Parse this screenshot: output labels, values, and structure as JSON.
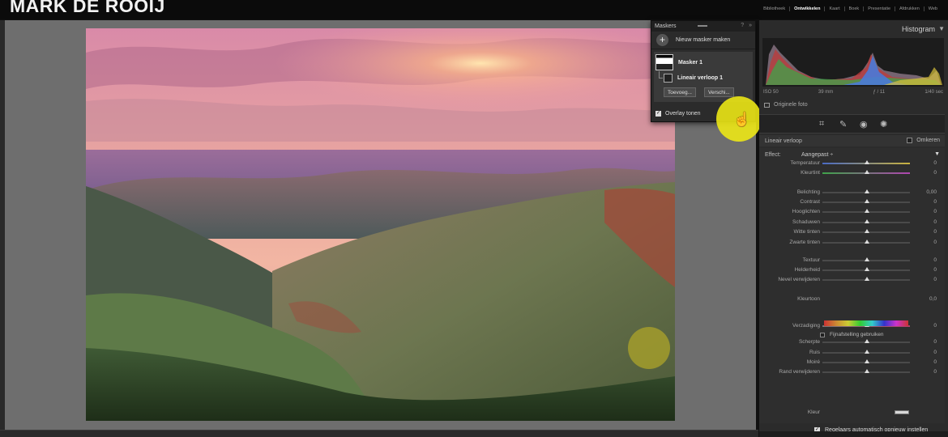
{
  "brand": "MARK DE ROOIJ",
  "modules": [
    {
      "label": "Bibliotheek",
      "active": false
    },
    {
      "label": "Ontwikkelen",
      "active": true
    },
    {
      "label": "Kaart",
      "active": false
    },
    {
      "label": "Boek",
      "active": false
    },
    {
      "label": "Presentatie",
      "active": false
    },
    {
      "label": "Afdrukken",
      "active": false
    },
    {
      "label": "Web",
      "active": false
    }
  ],
  "mask_panel": {
    "title": "Maskers",
    "new_mask": "Nieuw masker maken",
    "mask_name": "Masker 1",
    "sub_mask": "Lineair verloop 1",
    "add_button": "Toevoeg...",
    "subtract_button": "Verschi...",
    "overlay_label": "Overlay tonen",
    "overlay_checked": true
  },
  "histogram": {
    "title": "Histogram",
    "iso": "ISO 50",
    "focal": "39 mm",
    "aperture": "ƒ / 11",
    "shutter": "1/40 sec",
    "original_photo": "Originele foto"
  },
  "local_adjust": {
    "title": "Lineair verloop",
    "invert": "Omkeren",
    "effect_label": "Effect:",
    "effect_value": "Aangepast ÷",
    "sliders": [
      {
        "label": "Temperatuur",
        "value": "0",
        "track": "temp"
      },
      {
        "label": "Kleurtint",
        "value": "0",
        "track": "tint"
      },
      {
        "label": "Belichting",
        "value": "0,00",
        "track": "plain"
      },
      {
        "label": "Contrast",
        "value": "0",
        "track": "plain"
      },
      {
        "label": "Hooglichten",
        "value": "0",
        "track": "plain"
      },
      {
        "label": "Schaduwen",
        "value": "0",
        "track": "plain"
      },
      {
        "label": "Witte tinten",
        "value": "0",
        "track": "plain"
      },
      {
        "label": "Zwarte tinten",
        "value": "0",
        "track": "plain"
      },
      {
        "label": "Textuur",
        "value": "0",
        "track": "plain"
      },
      {
        "label": "Helderheid",
        "value": "0",
        "track": "plain"
      },
      {
        "label": "Nevel verwijderen",
        "value": "0",
        "track": "plain"
      },
      {
        "label": "Kleurtoon",
        "value": "0,0",
        "track": "hue"
      },
      {
        "label": "Verzadiging",
        "value": "0",
        "track": "sat"
      },
      {
        "label": "Scherpte",
        "value": "0",
        "track": "plain"
      },
      {
        "label": "Ruis",
        "value": "0",
        "track": "plain"
      },
      {
        "label": "Moiré",
        "value": "0",
        "track": "plain"
      },
      {
        "label": "Rand verwijderen",
        "value": "0",
        "track": "plain"
      }
    ],
    "fine_tune": "Fijnafstelling gebruiken",
    "color_label": "Kleur",
    "auto_reset": "Regelaars automatisch opnieuw instellen",
    "auto_reset_checked": true
  }
}
